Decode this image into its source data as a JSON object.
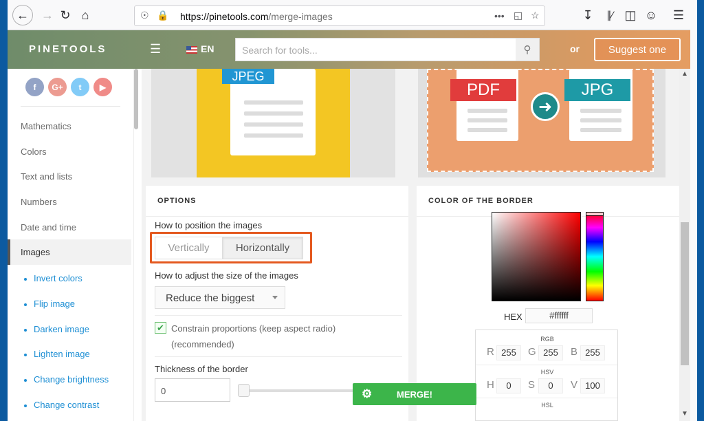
{
  "browser": {
    "url_host": "https://pinetools.com",
    "url_path": "/merge-images",
    "url_more": "•••"
  },
  "site": {
    "logo": "PINETOOLS",
    "lang": "EN",
    "search_placeholder": "Search for tools...",
    "or": "or",
    "suggest": "Suggest one"
  },
  "social": [
    "f",
    "G+",
    "t",
    "▶"
  ],
  "sidebar": {
    "categories": [
      "Mathematics",
      "Colors",
      "Text and lists",
      "Numbers",
      "Date and time"
    ],
    "active": "Images",
    "subitems": [
      "Invert colors",
      "Flip image",
      "Darken image",
      "Lighten image",
      "Change brightness",
      "Change contrast"
    ]
  },
  "banners": {
    "left_tag": "JPEG",
    "right_tag1": "PDF",
    "right_tag2": "JPG"
  },
  "options": {
    "title": "OPTIONS",
    "position_label": "How to position the images",
    "vertically": "Vertically",
    "horizontally": "Horizontally",
    "size_label": "How to adjust the size of the images",
    "size_value": "Reduce the biggest",
    "constrain": "Constrain proportions (keep aspect radio) (recommended)",
    "thickness_label": "Thickness of the border",
    "thickness_value": "0",
    "merge": "MERGE!"
  },
  "border_color": {
    "title": "COLOR OF THE BORDER",
    "hex_label": "HEX",
    "hex_value": "#ffffff",
    "rgb_label": "RGB",
    "r": "255",
    "g": "255",
    "b": "255",
    "hsv_label": "HSV",
    "h": "0",
    "s": "0",
    "v": "100",
    "hsl_label": "HSL"
  },
  "colors": {
    "accent_orange": "#e4591f",
    "merge_green": "#3cb54a",
    "link_blue": "#1e8fd4"
  }
}
